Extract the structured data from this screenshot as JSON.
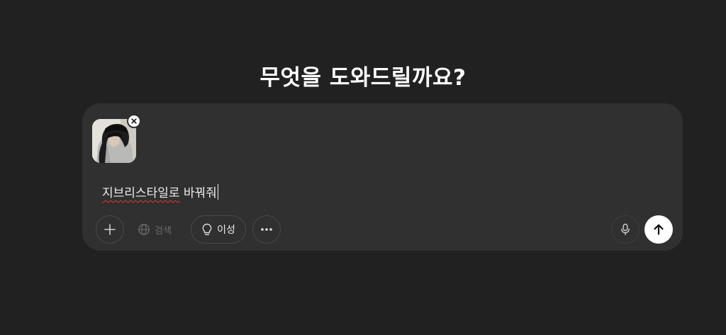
{
  "heading": "무엇을 도와드릴까요?",
  "composer": {
    "attachment_icon": "image-thumbnail",
    "remove_icon": "close-icon",
    "input_text": "지브리스타일로 바꿔줘",
    "input_misspelled_part": "지브리스타일로",
    "input_rest": " 바꿔줘"
  },
  "toolbar": {
    "add_icon": "plus-icon",
    "search_label": "검색",
    "search_icon": "globe-icon",
    "reason_label": "이성",
    "reason_icon": "lightbulb-icon",
    "more_icon": "ellipsis-icon",
    "mic_icon": "microphone-icon",
    "send_icon": "arrow-up-icon"
  },
  "colors": {
    "background": "#212121",
    "composer": "#303030",
    "send_button": "#ffffff",
    "spellcheck_underline": "#d93b3b"
  }
}
